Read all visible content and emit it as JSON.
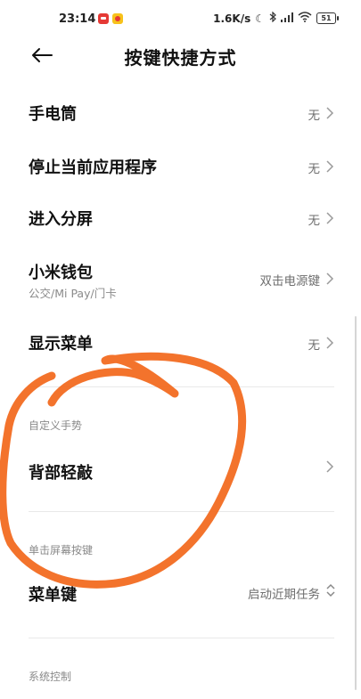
{
  "status_bar": {
    "time": "23:14",
    "net_speed": "1.6K/s",
    "icons": [
      "moon-icon",
      "bluetooth-icon",
      "signal-icon",
      "wifi-icon"
    ],
    "battery": "51"
  },
  "header": {
    "title": "按键快捷方式"
  },
  "items": [
    {
      "title": "手电筒",
      "value": "无"
    },
    {
      "title": "停止当前应用程序",
      "value": "无"
    },
    {
      "title": "进入分屏",
      "value": "无"
    },
    {
      "title": "小米钱包",
      "subtitle": "公交/Mi Pay/门卡",
      "value": "双击电源键"
    },
    {
      "title": "显示菜单",
      "value": "无"
    }
  ],
  "sections": {
    "custom_gesture": {
      "header": "自定义手势",
      "items": [
        {
          "title": "背部轻敲"
        }
      ]
    },
    "screen_button": {
      "header": "单击屏幕按键",
      "items": [
        {
          "title": "菜单键",
          "value": "启动近期任务"
        }
      ]
    },
    "system_control": {
      "header": "系统控制"
    }
  },
  "annotation_color": "#f26b21"
}
